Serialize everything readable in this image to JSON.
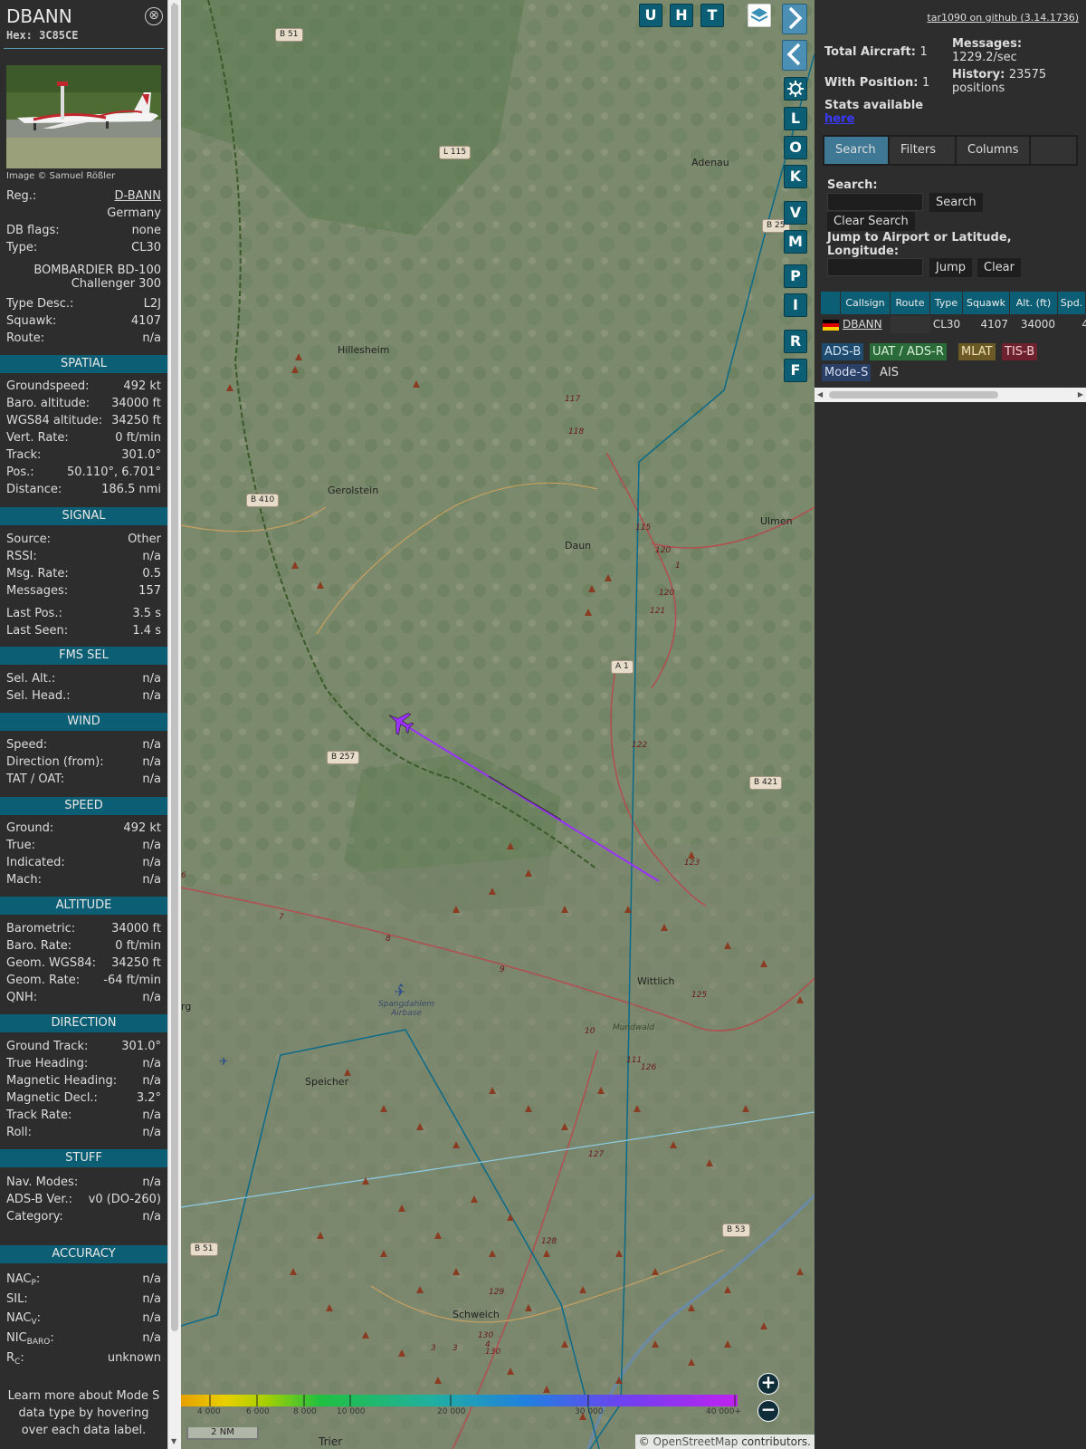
{
  "sidebar": {
    "callsign": "DBANN",
    "hex": "Hex: 3C85CE",
    "close": "⊗",
    "image_credit": "Image © Samuel Rößler",
    "reg_label": "Reg.:",
    "reg_value": "D-BANN",
    "country": "Germany",
    "dbflags_label": "DB flags:",
    "dbflags_value": "none",
    "type_label": "Type:",
    "type_value": "CL30",
    "type_name": "BOMBARDIER BD-100 Challenger 300",
    "typedesc_label": "Type Desc.:",
    "typedesc_value": "L2J",
    "squawk_label": "Squawk:",
    "squawk_value": "4107",
    "route_label": "Route:",
    "route_value": "n/a",
    "spatial": {
      "title": "SPATIAL",
      "rows": [
        {
          "l": "Groundspeed:",
          "v": "492 kt"
        },
        {
          "l": "Baro. altitude:",
          "v": "34000 ft"
        },
        {
          "l": "WGS84 altitude:",
          "v": "34250 ft"
        },
        {
          "l": "Vert. Rate:",
          "v": "0 ft/min"
        },
        {
          "l": "Track:",
          "v": "301.0°"
        },
        {
          "l": "Pos.:",
          "v": "50.110°, 6.701°"
        },
        {
          "l": "Distance:",
          "v": "186.5 nmi"
        }
      ]
    },
    "signal": {
      "title": "SIGNAL",
      "rows": [
        {
          "l": "Source:",
          "v": "Other"
        },
        {
          "l": "RSSI:",
          "v": "n/a"
        },
        {
          "l": "Msg. Rate:",
          "v": "0.5"
        },
        {
          "l": "Messages:",
          "v": "157"
        },
        {
          "l": "Last Pos.:",
          "v": "3.5 s"
        },
        {
          "l": "Last Seen:",
          "v": "1.4 s"
        }
      ]
    },
    "fms": {
      "title": "FMS SEL",
      "rows": [
        {
          "l": "Sel. Alt.:",
          "v": "n/a"
        },
        {
          "l": "Sel. Head.:",
          "v": "n/a"
        }
      ]
    },
    "wind": {
      "title": "WIND",
      "rows": [
        {
          "l": "Speed:",
          "v": "n/a"
        },
        {
          "l": "Direction (from):",
          "v": "n/a"
        },
        {
          "l": "TAT / OAT:",
          "v": "n/a"
        }
      ]
    },
    "speed": {
      "title": "SPEED",
      "rows": [
        {
          "l": "Ground:",
          "v": "492 kt"
        },
        {
          "l": "True:",
          "v": "n/a"
        },
        {
          "l": "Indicated:",
          "v": "n/a"
        },
        {
          "l": "Mach:",
          "v": "n/a"
        }
      ]
    },
    "altitude": {
      "title": "ALTITUDE",
      "rows": [
        {
          "l": "Barometric:",
          "v": "34000 ft"
        },
        {
          "l": "Baro. Rate:",
          "v": "0 ft/min"
        },
        {
          "l": "Geom. WGS84:",
          "v": "34250 ft"
        },
        {
          "l": "Geom. Rate:",
          "v": "-64 ft/min"
        },
        {
          "l": "QNH:",
          "v": "n/a"
        }
      ]
    },
    "direction": {
      "title": "DIRECTION",
      "rows": [
        {
          "l": "Ground Track:",
          "v": "301.0°"
        },
        {
          "l": "True Heading:",
          "v": "n/a"
        },
        {
          "l": "Magnetic Heading:",
          "v": "n/a"
        },
        {
          "l": "Magnetic Decl.:",
          "v": "3.2°"
        },
        {
          "l": "Track Rate:",
          "v": "n/a"
        },
        {
          "l": "Roll:",
          "v": "n/a"
        }
      ]
    },
    "stuff": {
      "title": "STUFF",
      "rows": [
        {
          "l": "Nav. Modes:",
          "v": "n/a"
        },
        {
          "l": "ADS-B Ver.:",
          "v": "v0 (DO-260)"
        },
        {
          "l": "Category:",
          "v": "n/a"
        }
      ]
    },
    "accuracy": {
      "title": "ACCURACY",
      "nacp": "NAC",
      "nacp_sub": "P",
      "nacp_v": "n/a",
      "sil": "SIL:",
      "sil_v": "n/a",
      "nacv": "NAC",
      "nacv_sub": "V",
      "nacv_v": "n/a",
      "nic": "NIC",
      "nic_sub": "BARO",
      "nic_v": "n/a",
      "rc": "R",
      "rc_sub": "C",
      "rc_v": "unknown"
    },
    "note": "Learn more about Mode S data type by hovering over each data label."
  },
  "map": {
    "toolbar_top": [
      "U",
      "H",
      "T"
    ],
    "toolbar_side": [
      "L",
      "O",
      "K",
      "V",
      "M",
      "P",
      "I",
      "R",
      "F"
    ],
    "places": [
      "Adenau",
      "Hillesheim",
      "Gerolstein",
      "Daun",
      "Ulmen",
      "Wittlich",
      "Speicher",
      "Spangdahlem Airbase",
      "Schweich",
      "Trier",
      "Mundwald",
      "rg"
    ],
    "roads": [
      "B 51",
      "L 115",
      "B 410",
      "A 1",
      "B 257",
      "B 421",
      "B 53",
      "B 51",
      "B 25"
    ],
    "numbers": [
      "117",
      "118",
      "115",
      "120",
      "120",
      "121",
      "122",
      "123",
      "125",
      "126",
      "127",
      "128",
      "129",
      "130",
      "130",
      "7",
      "8",
      "9",
      "10",
      "6",
      "3",
      "3",
      "4",
      "1",
      "111"
    ],
    "colorbar": [
      "4 000",
      "6 000",
      "8 000",
      "10 000",
      "20 000",
      "30 000",
      "40 000+"
    ],
    "scale": "2 NM",
    "attribution_pre": "© ",
    "attribution_link": "OpenStreetMap",
    "attribution_post": " contributors.",
    "zoom_in": "+",
    "zoom_out": "−",
    "track_color": "#9b30ff"
  },
  "panel": {
    "github": "tar1090 on github (3.14.1736)",
    "total_label": "Total Aircraft:",
    "total_value": "1",
    "messages_label": "Messages:",
    "messages_value": "1229.2/sec",
    "withpos_label": "With Position:",
    "withpos_value": "1",
    "history_label": "History:",
    "history_value": "23575 positions",
    "stats_label": "Stats available",
    "stats_link": "here",
    "tabs": [
      "Search",
      "Filters",
      "Columns"
    ],
    "search_label": "Search:",
    "search_button": "Search",
    "clear_search": "Clear Search",
    "jump_label": "Jump to Airport or Latitude, Longitude:",
    "jump_button": "Jump",
    "clear_button": "Clear",
    "columns": [
      "Callsign",
      "Route",
      "Type",
      "Squawk",
      "Alt. (ft)",
      "Spd."
    ],
    "row": {
      "callsign": "DBANN",
      "route": "",
      "type": "CL30",
      "squawk": "4107",
      "alt": "34000",
      "spd": "4"
    },
    "sources": [
      {
        "name": "ADS-B",
        "bg": "#1f4b6e",
        "fg": "#cfe3f4"
      },
      {
        "name": "UAT / ADS-R",
        "bg": "#2b6b3a",
        "fg": "#d7f0d8"
      },
      {
        "name": "MLAT",
        "bg": "#6b5a25",
        "fg": "#f2e3b8"
      },
      {
        "name": "TIS-B",
        "bg": "#6e2230",
        "fg": "#f3cfd4"
      },
      {
        "name": "Mode-S",
        "bg": "#2a3f66",
        "fg": "#d6def1"
      },
      {
        "name": "AIS",
        "bg": "#2d2d2d",
        "fg": "#dddddd"
      }
    ]
  }
}
